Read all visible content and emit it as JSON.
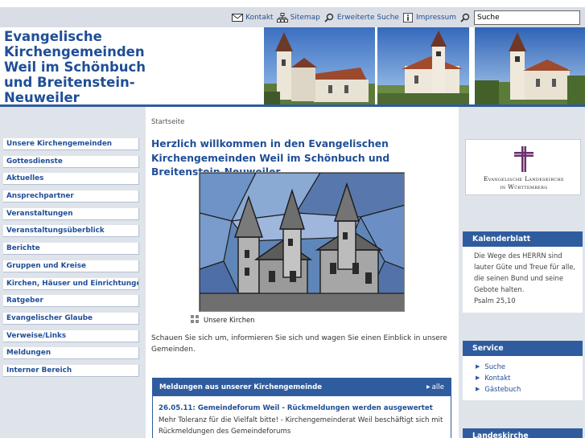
{
  "util_nav": {
    "kontakt": "Kontakt",
    "sitemap": "Sitemap",
    "erweiterte_suche": "Erweiterte Suche",
    "impressum": "Impressum",
    "search_value": "Suche"
  },
  "header": {
    "title": "Evangelische Kirchengemeinden Weil im Schönbuch und Breitenstein-Neuweiler"
  },
  "sidebar": {
    "items": [
      {
        "label": "Unsere Kirchengemeinden"
      },
      {
        "label": "Gottesdienste"
      },
      {
        "label": "Aktuelles"
      },
      {
        "label": "Ansprechpartner"
      },
      {
        "label": "Veranstaltungen"
      },
      {
        "label": "Veranstaltungsüberblick"
      },
      {
        "label": "Berichte"
      },
      {
        "label": "Gruppen und Kreise"
      },
      {
        "label": "Kirchen, Häuser und Einrichtungen"
      },
      {
        "label": "Ratgeber"
      },
      {
        "label": "Evangelischer Glaube"
      },
      {
        "label": "Verweise/Links"
      },
      {
        "label": "Meldungen"
      },
      {
        "label": "Interner Bereich"
      }
    ]
  },
  "main": {
    "breadcrumb": "Startseite",
    "title": "Herzlich willkommen in den Evangelischen Kirchengemeinden Weil im Schönbuch und Breitenstein-Neuweiler",
    "image_caption": "Unsere Kirchen",
    "intro": "Schauen Sie sich um, informieren Sie sich und wagen Sie einen Einblick in unsere Gemeinden.",
    "news": {
      "header": "Meldungen aus unserer Kirchengemeinde",
      "all_label": "alle",
      "item_title": "26.05.11: Gemeindeforum Weil - Rückmeldungen werden ausgewertet",
      "item_text": "Mehr Toleranz für die Vielfalt bitte! - Kirchengemeinderat Weil beschäftigt sich mit Rückmeldungen des Gemeindeforums"
    }
  },
  "right": {
    "elk_line1": "Evangelische Landeskirche",
    "elk_line2": "in Württemberg",
    "kalender": {
      "title": "Kalenderblatt",
      "text": "Die Wege des HERRN sind lauter Güte und Treue für alle, die seinen Bund und seine Gebote halten.",
      "ref": "Psalm 25,10"
    },
    "service": {
      "title": "Service",
      "links": [
        "Suche",
        "Kontakt",
        "Gästebuch"
      ]
    },
    "landeskirche_title": "Landeskirche"
  },
  "colors": {
    "brand_blue": "#2f5c9e",
    "title_blue": "#1f4e96",
    "side_bg": "#dfe3ea",
    "elk_purple": "#6b2f6e"
  }
}
